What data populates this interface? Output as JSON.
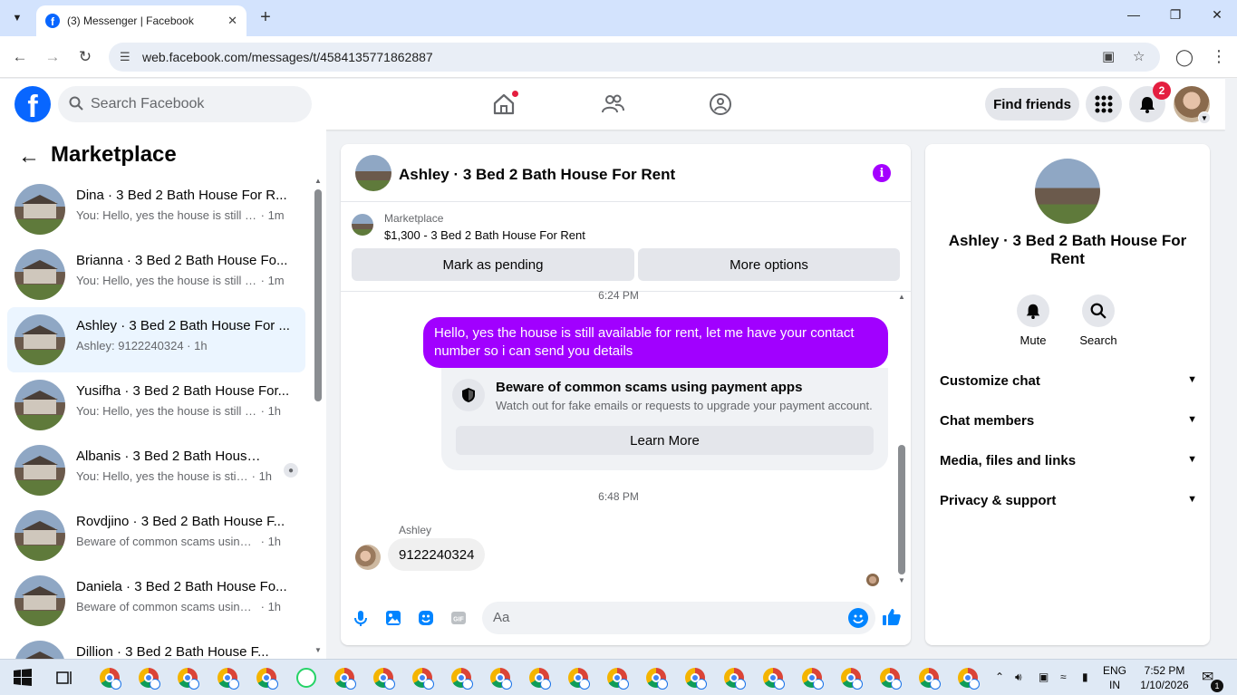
{
  "browser": {
    "tab_title": "(3) Messenger | Facebook",
    "url": "web.facebook.com/messages/t/4584135771862887"
  },
  "fb_header": {
    "search_placeholder": "Search Facebook",
    "find_friends_label": "Find friends",
    "notification_count": "2"
  },
  "left_panel": {
    "title": "Marketplace",
    "conversations": [
      {
        "name": "Dina · 3 Bed 2 Bath House For R...",
        "snippet": "You: Hello, yes the house is still av...",
        "time": "· 1m"
      },
      {
        "name": "Brianna · 3 Bed 2 Bath House Fo...",
        "snippet": "You: Hello, yes the house is still av...",
        "time": "· 1m"
      },
      {
        "name": "Ashley · 3 Bed 2 Bath House For ...",
        "snippet": "Ashley: 9122240324",
        "time": "· 1h"
      },
      {
        "name": "Yusifha · 3 Bed 2 Bath House For...",
        "snippet": "You: Hello, yes the house is still avai...",
        "time": "· 1h"
      },
      {
        "name": "Albanis · 3 Bed 2 Bath House ...",
        "snippet": "You: Hello, yes the house is still a...",
        "time": "· 1h"
      },
      {
        "name": "Rovdjino · 3 Bed 2 Bath House F...",
        "snippet": "Beware of common scams using pa...",
        "time": "· 1h"
      },
      {
        "name": "Daniela · 3 Bed 2 Bath House Fo...",
        "snippet": "Beware of common scams using pa...",
        "time": "· 1h"
      },
      {
        "name": "Dillion · 3 Bed 2 Bath House F...",
        "snippet": "",
        "time": ""
      }
    ]
  },
  "chat": {
    "title": "Ashley · 3 Bed 2 Bath House For Rent",
    "marketplace_label": "Marketplace",
    "listing": "$1,300 - 3 Bed 2 Bath House For Rent",
    "mark_pending_label": "Mark as pending",
    "more_options_label": "More options",
    "timestamp1": "6:24 PM",
    "outgoing_message": "Hello, yes the house is still available for rent, let me have your contact number so i can send you  details",
    "scam_title": "Beware of common scams using payment apps",
    "scam_body": "Watch out for fake emails or requests to upgrade your payment account.",
    "learn_more_label": "Learn More",
    "timestamp2": "6:48 PM",
    "sender_name": "Ashley",
    "incoming_message": "9122240324",
    "composer_placeholder": "Aa"
  },
  "right_panel": {
    "name": "Ashley · 3 Bed 2 Bath House For Rent",
    "mute_label": "Mute",
    "search_label": "Search",
    "sections": [
      "Customize chat",
      "Chat members",
      "Media, files and links",
      "Privacy & support"
    ]
  },
  "taskbar": {
    "lang_line1": "ENG",
    "lang_line2": "IN",
    "time": "7:52 PM",
    "date": "1/10/2026",
    "notification_count": "1"
  },
  "colors": {
    "facebook_blue": "#0866ff",
    "messenger_purple": "#a100ff",
    "notification_red": "#e41e3f",
    "active_conversation_bg": "#ebf5ff"
  }
}
